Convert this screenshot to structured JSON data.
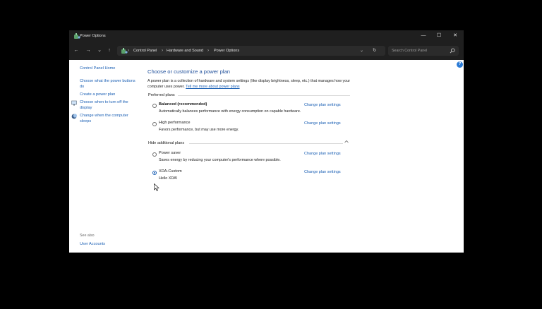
{
  "window": {
    "title": "Power Options",
    "controls": {
      "minimize": "—",
      "maximize": "☐",
      "close": "✕"
    }
  },
  "nav": {
    "back": "←",
    "forward": "→",
    "recent": "⌄",
    "up": "↑",
    "breadcrumb": [
      "Control Panel",
      "Hardware and Sound",
      "Power Options"
    ],
    "separator": "›",
    "dropdown": "⌄",
    "refresh": "↻",
    "search_placeholder": "Search Control Panel"
  },
  "sidebar": {
    "home": "Control Panel Home",
    "items": [
      {
        "label": "Choose what the power buttons do",
        "icon": "none"
      },
      {
        "label": "Create a power plan",
        "icon": "none"
      },
      {
        "label": "Choose when to turn off the display",
        "icon": "monitor-icon"
      },
      {
        "label": "Change when the computer sleeps",
        "icon": "moon-icon"
      }
    ],
    "see_also_label": "See also",
    "see_also_links": [
      "User Accounts"
    ]
  },
  "main": {
    "heading": "Choose or customize a power plan",
    "intro": "A power plan is a collection of hardware and system settings (like display brightness, sleep, etc.) that manages how your computer uses power.",
    "intro_link": "Tell me more about power plans",
    "preferred_title": "Preferred plans",
    "additional_title": "Hide additional plans",
    "plans": [
      {
        "name": "Balanced (recommended)",
        "desc": "Automatically balances performance with energy consumption on capable hardware.",
        "link": "Change plan settings",
        "selected": false
      },
      {
        "name": "High performance",
        "desc": "Favors performance, but may use more energy.",
        "link": "Change plan settings",
        "selected": false
      },
      {
        "name": "Power saver",
        "desc": "Saves energy by reducing your computer's performance where possible.",
        "link": "Change plan settings",
        "selected": false
      },
      {
        "name": "XDA-Custom",
        "desc": "Hello XDA!",
        "link": "Change plan settings",
        "selected": true
      }
    ]
  },
  "colors": {
    "link": "#1a5fb4",
    "heading": "#1e4e9a",
    "titlebar": "#1f1f1f"
  }
}
